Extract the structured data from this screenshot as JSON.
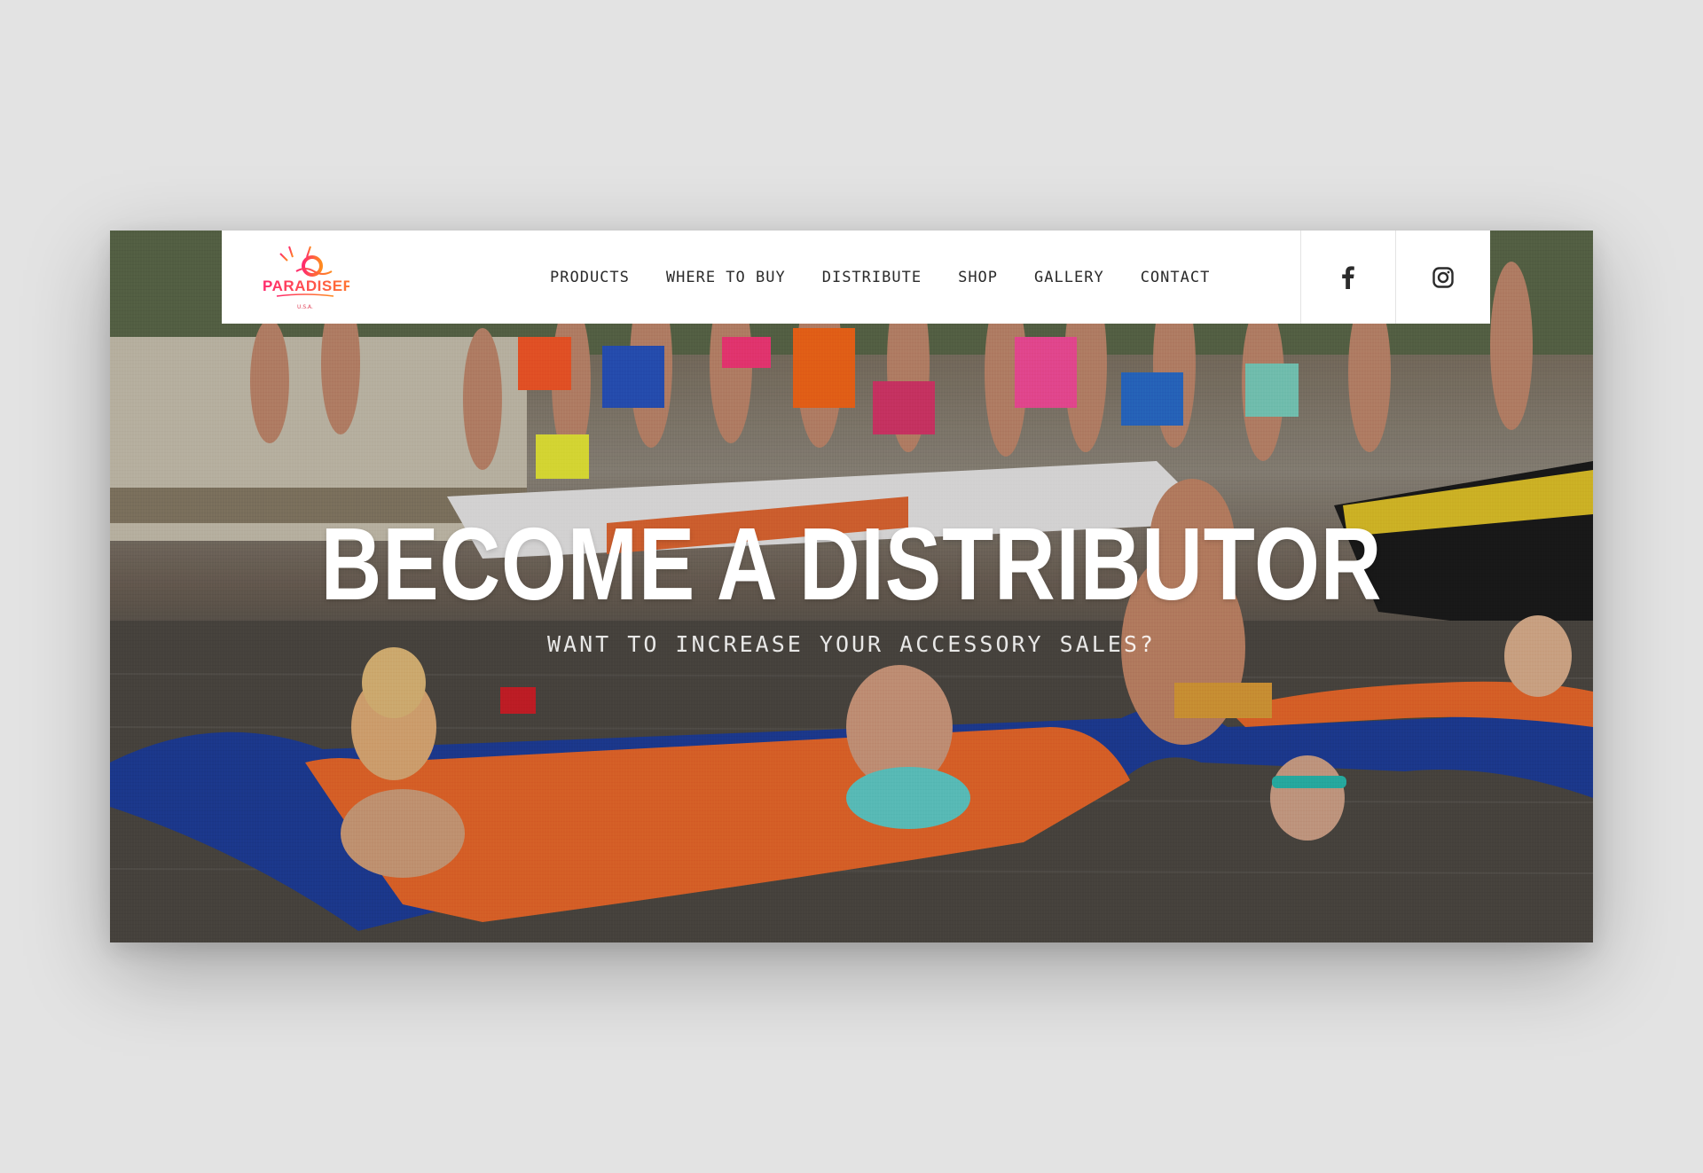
{
  "brand": {
    "logo_text": "PARADISEPAD",
    "logo_tagline": "",
    "logo_country": "U.S.A."
  },
  "nav": {
    "items": [
      {
        "label": "PRODUCTS"
      },
      {
        "label": "WHERE TO BUY"
      },
      {
        "label": "DISTRIBUTE"
      },
      {
        "label": "SHOP"
      },
      {
        "label": "GALLERY"
      },
      {
        "label": "CONTACT"
      }
    ]
  },
  "social": {
    "facebook_icon": "facebook-icon",
    "instagram_icon": "instagram-icon"
  },
  "hero": {
    "title": "BECOME A DISTRIBUTOR",
    "subtitle": "WANT TO INCREASE YOUR ACCESSORY SALES?",
    "image_alt": "lake party on a floating pad"
  },
  "colors": {
    "page_background": "#e3e3e3",
    "header_background": "#ffffff",
    "nav_text": "#2b2b2b",
    "logo_gradient_start": "#ff2a6d",
    "logo_gradient_end": "#ff9a1f",
    "pad_orange": "#f26c2c",
    "pad_blue": "#1f3f9e",
    "water": "#4e4b44"
  }
}
